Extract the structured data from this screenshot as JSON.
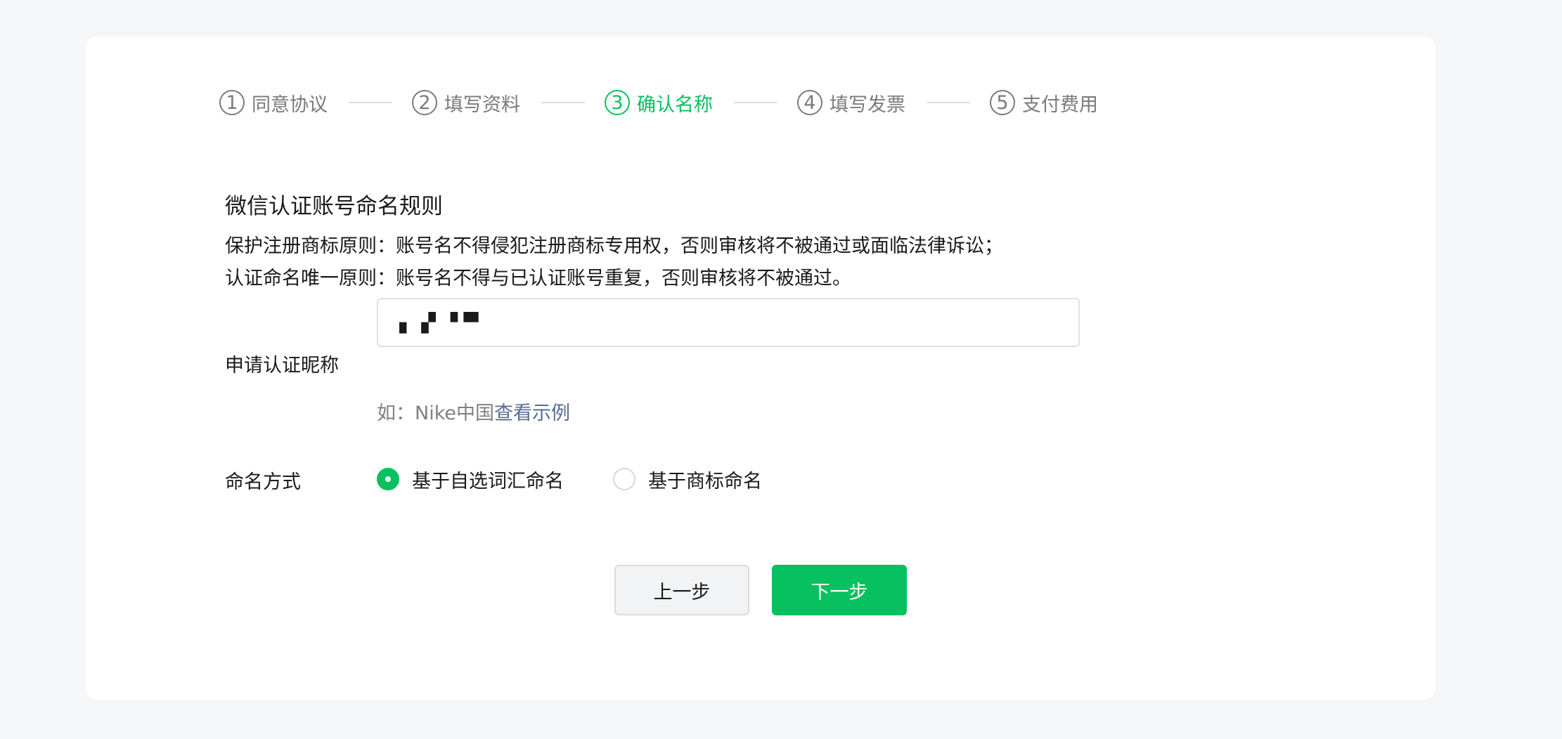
{
  "steps": [
    {
      "num": "1",
      "label": "同意协议"
    },
    {
      "num": "2",
      "label": "填写资料"
    },
    {
      "num": "3",
      "label": "确认名称"
    },
    {
      "num": "4",
      "label": "填写发票"
    },
    {
      "num": "5",
      "label": "支付费用"
    }
  ],
  "active_step": 3,
  "rules": {
    "title": "微信认证账号命名规则",
    "line1": "保护注册商标原则：账号名不得侵犯注册商标专用权，否则审核将不被通过或面临法律诉讼；",
    "line2": "认证命名唯一原则：账号名不得与已认证账号重复，否则审核将不被通过。"
  },
  "form": {
    "nickname_label": "申请认证昵称",
    "nickname_value": "▖▗▘▝ ▀",
    "hint_prefix": "如：Nike中国",
    "hint_link": "查看示例",
    "method_label": "命名方式",
    "method_options": [
      "基于自选词汇命名",
      "基于商标命名"
    ],
    "method_selected": 0
  },
  "buttons": {
    "prev": "上一步",
    "next": "下一步"
  },
  "colors": {
    "accent": "#07c160",
    "link": "#576b95"
  }
}
